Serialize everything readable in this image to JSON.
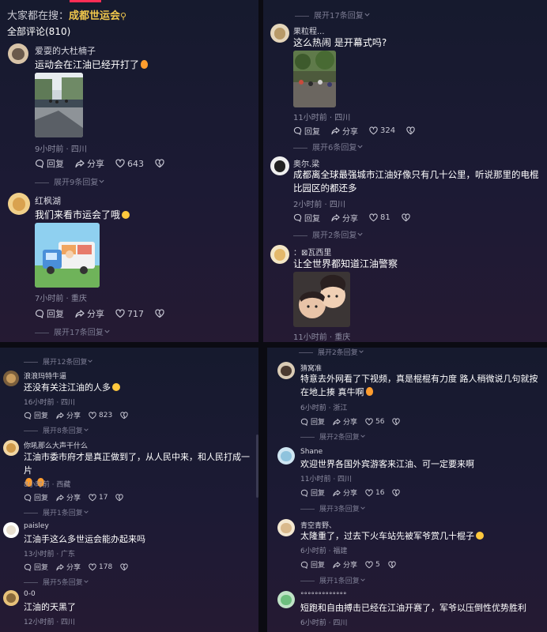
{
  "header": {
    "search_hint": "大家都在搜：",
    "search_term": "成都世运会",
    "total_comments": "全部评论(810)"
  },
  "labels": {
    "reply": "回复",
    "share": "分享"
  },
  "panel_tl": {
    "comments": [
      {
        "username": "爱耍的大杜楠子",
        "text": "运动会在江油已经开打了",
        "time": "9小时前",
        "location": "四川",
        "likes": "643",
        "expand": "展开9条回复"
      },
      {
        "username": "红枫湖",
        "text": "我们来看市运会了哦",
        "time": "7小时前",
        "location": "重庆",
        "likes": "717",
        "expand": "展开17条回复"
      }
    ]
  },
  "panel_tr": {
    "top_expand": "展开17条回复",
    "comments": [
      {
        "username": "果粒程...",
        "text": "这么热闹 是开幕式吗?",
        "time": "11小时前",
        "location": "四川",
        "likes": "324",
        "expand": "展开6条回复"
      },
      {
        "username": "奥尔.梁",
        "text": "成都离全球最强城市江油好像只有几十公里，听说那里的电棍比园区的都还多",
        "time": "2小时前",
        "location": "四川",
        "likes": "81",
        "expand": "展开2条回复"
      },
      {
        "username": "⊠瓦西里",
        "username_prefix": "：",
        "text": "让全世界都知道江油警察",
        "time": "11小时前",
        "location": "重庆"
      }
    ]
  },
  "panel_bl": {
    "top_expand": "展开12条回复",
    "comments": [
      {
        "username": "浪浪玛特牛逼",
        "text": "还没有关注江油的人多",
        "time": "16小时前",
        "location": "四川",
        "likes": "823",
        "expand": "展开8条回复"
      },
      {
        "username": "你吼那么大声干什么",
        "text": "江油市委市府才是真正做到了，从人民中来，和人民打成一片",
        "time": "8小时前",
        "location": "西藏",
        "likes": "17",
        "expand": "展开1条回复"
      },
      {
        "username": "paisley",
        "text": "江油手这么多世运会能办起来吗",
        "time": "13小时前",
        "location": "广东",
        "likes": "178",
        "expand": "展开5条回复"
      },
      {
        "username": "0-0",
        "text": "江油的天黑了",
        "time": "12小时前",
        "location": "四川"
      }
    ]
  },
  "panel_br": {
    "top_expand": "展开2条回复",
    "comments": [
      {
        "username": "猜窝准",
        "text": "特意去外网看了下视频，真是棍棍有力度 路人稍微说几句就按在地上揍 真牛啊",
        "time": "6小时前",
        "location": "浙江",
        "likes": "56",
        "expand": "展开2条回复"
      },
      {
        "username": "Shane",
        "text": "欢迎世界各国外宾游客来江油、可一定要来啊",
        "time": "11小时前",
        "location": "四川",
        "likes": "16",
        "expand": "展开3条回复"
      },
      {
        "username": "青空青野、",
        "text": "太隆重了，过去下火车站先被军爷赏几十棍子",
        "time": "6小时前",
        "location": "福建",
        "likes": "5",
        "expand": "展开1条回复"
      },
      {
        "username": "°°°°°°°°°°°°°",
        "text": "短跑和自由搏击已经在江油开赛了，军爷以压倒性优势胜利",
        "time": "6小时前",
        "location": "四川"
      }
    ]
  },
  "colors": {
    "accent": "#f2c94c",
    "like": "#e8e8f0",
    "meta": "#8e8ea3"
  }
}
